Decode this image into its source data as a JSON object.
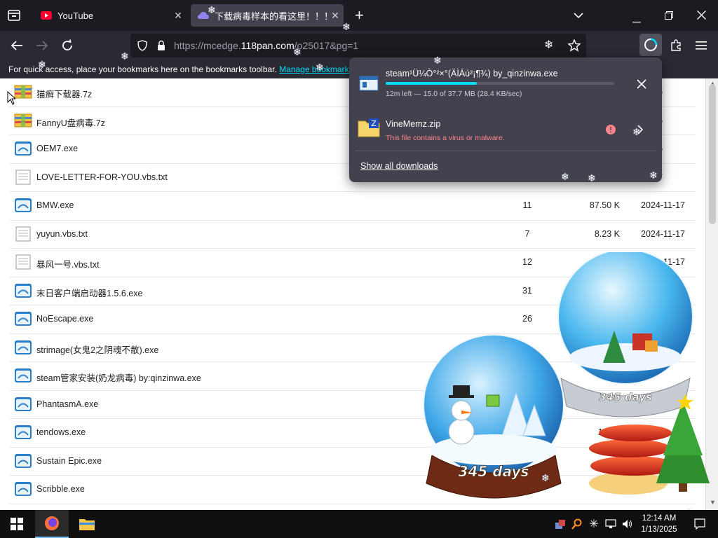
{
  "browser": {
    "tabs": [
      {
        "title": "YouTube",
        "close": "✕"
      },
      {
        "title": "下载病毒样本的看这里！！！(",
        "close": "✕"
      }
    ],
    "new_tab": "+",
    "url": {
      "prefix": "https://mcedge.",
      "domain": "118pan.com",
      "suffix": "/o25017&pg=1"
    },
    "bookmarks_bar": {
      "text": "For quick access, place your bookmarks here on the bookmarks toolbar.",
      "link": "Manage bookmarks..."
    }
  },
  "files": [
    {
      "name": "猫癣下载器.7z",
      "icon": "archive-icon",
      "count": "",
      "size": "",
      "date": "11-26"
    },
    {
      "name": "FannyU盘病毒.7z",
      "icon": "archive-icon",
      "count": "",
      "size": "",
      "date": "11-26"
    },
    {
      "name": "OEM7.exe",
      "icon": "exe-icon",
      "count": "",
      "size": "",
      "date": "11-26"
    },
    {
      "name": "LOVE-LETTER-FOR-YOU.vbs.txt",
      "icon": "text-file-icon",
      "count": "",
      "size": "",
      "date": "11-17"
    },
    {
      "name": "BMW.exe",
      "icon": "exe-icon",
      "count": "11",
      "size": "87.50 K",
      "date": "2024-11-17"
    },
    {
      "name": "yuyun.vbs.txt",
      "icon": "text-file-icon",
      "count": "7",
      "size": "8.23 K",
      "date": "2024-11-17"
    },
    {
      "name": "暴风一号.vbs.txt",
      "icon": "text-file-icon",
      "count": "12",
      "size": "19.75",
      "date": "2024-11-17"
    },
    {
      "name": "末日客户端启动器1.5.6.exe",
      "icon": "exe-icon",
      "count": "31",
      "size": "",
      "date": "9"
    },
    {
      "name": "NoEscape.exe",
      "icon": "exe-icon",
      "count": "26",
      "size": "",
      "date": ""
    },
    {
      "name": "strimage(女鬼2之阴魂不散).exe",
      "icon": "exe-icon",
      "count": "",
      "size": "",
      "date": ""
    },
    {
      "name": "steam管家安装(奶龙病毒) by:qinzinwa.exe",
      "icon": "exe-icon",
      "count": "",
      "size": "",
      "date": "06"
    },
    {
      "name": "PhantasmA.exe",
      "icon": "exe-icon",
      "count": "",
      "size": "",
      "date": ""
    },
    {
      "name": "tendows.exe",
      "icon": "exe-icon",
      "count": "",
      "size": "184.0",
      "date": ""
    },
    {
      "name": "Sustain Epic.exe",
      "icon": "exe-icon",
      "count": "",
      "size": "18",
      "date": ""
    },
    {
      "name": "Scribble.exe",
      "icon": "exe-icon",
      "count": "",
      "size": "15",
      "date": ""
    }
  ],
  "downloads": {
    "items": [
      {
        "name": "steam¹Ü¼Ò°²×°(ÄÌÁú²¡¶¾) by_qinzinwa.exe",
        "status": "12m left — 15.0 of 37.7 MB (28.4 KB/sec)",
        "progress": 0.4
      },
      {
        "name": "VineMemz.zip",
        "status": "This file contains a virus or malware."
      }
    ],
    "show_all": "Show all downloads"
  },
  "decorations": {
    "globe_left": "345 days",
    "globe_right": "345 days"
  },
  "taskbar": {
    "time": "12:14 AM",
    "date": "1/13/2025"
  },
  "colors": {
    "accent": "#00ddff",
    "warning": "#ff848b",
    "tab_active": "#42414d",
    "toolbar": "#2b2a33"
  }
}
